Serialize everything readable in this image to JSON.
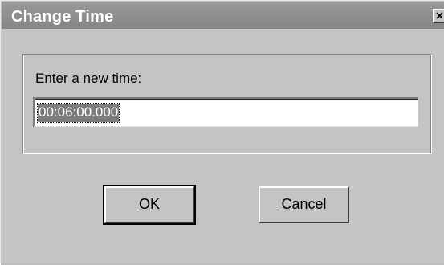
{
  "window": {
    "title": "Change Time",
    "close_icon": "close-icon"
  },
  "form": {
    "prompt": "Enter a new time:",
    "time_value": "00:06:00.000"
  },
  "buttons": {
    "ok_mnemonic": "O",
    "ok_rest": "K",
    "cancel_mnemonic": "C",
    "cancel_rest": "ancel"
  },
  "colors": {
    "titlebar": "#8a8a8a",
    "dialog_face": "#c4c4c4",
    "selection": "#7d7d7d"
  }
}
